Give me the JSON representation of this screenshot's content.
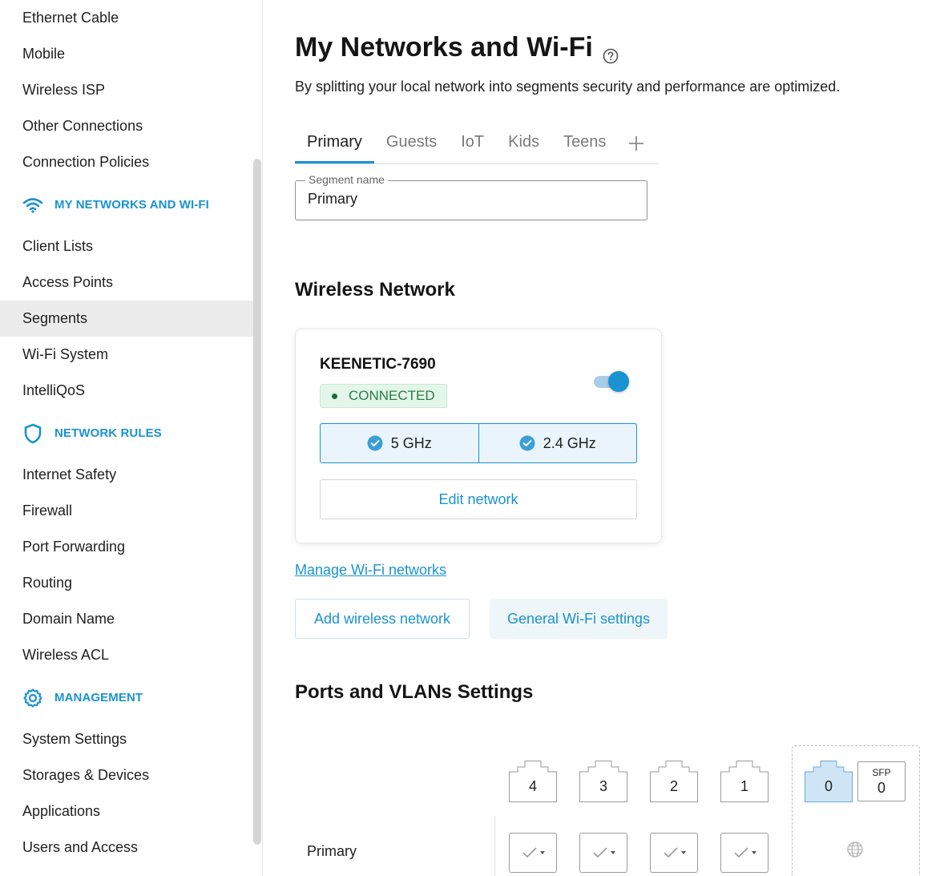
{
  "sidebar": {
    "items_top": [
      "Ethernet Cable",
      "Mobile",
      "Wireless ISP",
      "Other Connections",
      "Connection Policies"
    ],
    "section_networks": "MY NETWORKS AND WI-FI",
    "items_networks": [
      "Client Lists",
      "Access Points",
      "Segments",
      "Wi-Fi System",
      "IntelliQoS"
    ],
    "active_item": "Segments",
    "section_rules": "NETWORK RULES",
    "items_rules": [
      "Internet Safety",
      "Firewall",
      "Port Forwarding",
      "Routing",
      "Domain Name",
      "Wireless ACL"
    ],
    "section_management": "MANAGEMENT",
    "items_management": [
      "System Settings",
      "Storages & Devices",
      "Applications",
      "Users and Access"
    ]
  },
  "page": {
    "title": "My Networks and Wi-Fi",
    "description": "By splitting your local network into segments security and performance are optimized."
  },
  "tabs": [
    "Primary",
    "Guests",
    "IoT",
    "Kids",
    "Teens"
  ],
  "active_tab": "Primary",
  "segment_field": {
    "label": "Segment name",
    "value": "Primary"
  },
  "wireless": {
    "section_title": "Wireless Network",
    "network_name": "KEENETIC-7690",
    "status": "CONNECTED",
    "enabled": true,
    "bands": [
      "5 GHz",
      "2.4 GHz"
    ],
    "edit_label": "Edit network",
    "manage_link": "Manage Wi-Fi networks",
    "add_label": "Add wireless network",
    "general_label": "General Wi-Fi settings"
  },
  "ports": {
    "section_title": "Ports and VLANs Settings",
    "lan_ports": [
      "4",
      "3",
      "2",
      "1"
    ],
    "wan_port": "0",
    "sfp_label": "SFP",
    "sfp_port": "0",
    "row_label": "Primary"
  },
  "colors": {
    "accent": "#1a93d2",
    "connected_bg": "#e4f5ea",
    "connected_text": "#2b7d49"
  }
}
